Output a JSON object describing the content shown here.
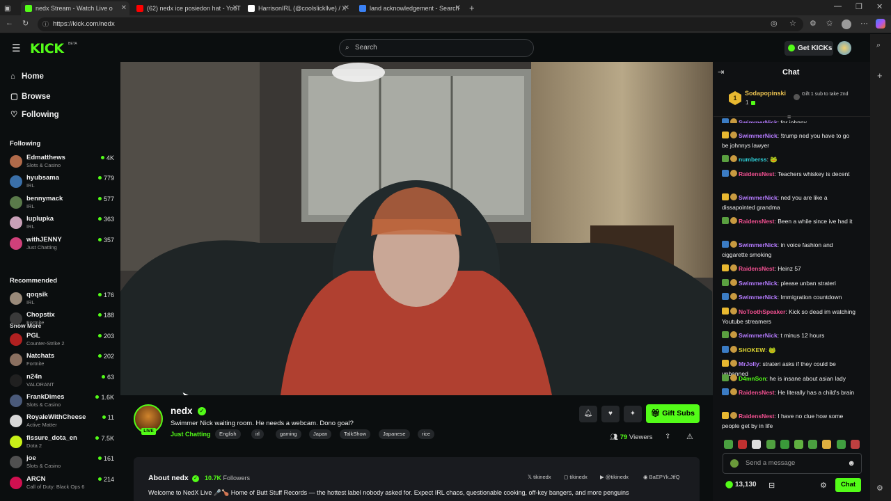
{
  "browser": {
    "tabs": [
      {
        "title": "nedx Stream - Watch Live o",
        "active": true,
        "icon_color": "#53fc18"
      },
      {
        "title": "(62) nedx ice posiedon hat - YouT",
        "active": false,
        "icon_color": "#ff0000"
      },
      {
        "title": "HarrisonIRL (@coolslickllve) / X",
        "active": false,
        "icon_color": "#ffffff"
      },
      {
        "title": "land acknowledgement - Search",
        "active": false,
        "icon_color": "#3b82f6"
      }
    ],
    "url": "https://kick.com/nedx"
  },
  "topbar": {
    "logo": "KICK",
    "logo_beta": "BETA",
    "search_placeholder": "Search",
    "get_kicks": "Get KICKs"
  },
  "sidebar": {
    "nav": [
      {
        "label": "Home",
        "icon": "home-icon"
      },
      {
        "label": "Browse",
        "icon": "browse-icon"
      },
      {
        "label": "Following",
        "icon": "heart-icon"
      }
    ],
    "following_title": "Following",
    "following": [
      {
        "name": "Edmatthews",
        "category": "Slots & Casino",
        "viewers": "4K",
        "color": "#b06a4a"
      },
      {
        "name": "hyubsama",
        "category": "IRL",
        "viewers": "779",
        "color": "#3a6fa8"
      },
      {
        "name": "bennymack",
        "category": "IRL",
        "viewers": "577",
        "color": "#5a7a4a"
      },
      {
        "name": "luplupka",
        "category": "IRL",
        "viewers": "363",
        "color": "#c9a0b8"
      },
      {
        "name": "withJENNY",
        "category": "Just Chatting",
        "viewers": "357",
        "color": "#d0407a"
      }
    ],
    "show_more": "Show More",
    "recommended_title": "Recommended",
    "recommended": [
      {
        "name": "qoqsik",
        "category": "IRL",
        "viewers": "176",
        "color": "#9a8a7a"
      },
      {
        "name": "Chopstix",
        "category": "Fortnite",
        "viewers": "188",
        "color": "#3a3a3a"
      },
      {
        "name": "PGL",
        "category": "Counter-Strike 2",
        "viewers": "203",
        "color": "#b02020"
      },
      {
        "name": "Natchats",
        "category": "Fortnite",
        "viewers": "202",
        "color": "#8a7060"
      },
      {
        "name": "n24n",
        "category": "VALORANT",
        "viewers": "63",
        "color": "#202020"
      },
      {
        "name": "FrankDimes",
        "category": "Slots & Casino",
        "viewers": "1.6K",
        "color": "#4a5a7a"
      },
      {
        "name": "RoyaleWithCheese",
        "category": "Active Matter",
        "viewers": "11",
        "color": "#d8d8d8"
      },
      {
        "name": "fissure_dota_en",
        "category": "Dota 2",
        "viewers": "7.5K",
        "color": "#c8f018"
      },
      {
        "name": "joe",
        "category": "Slots & Casino",
        "viewers": "161",
        "color": "#505050"
      },
      {
        "name": "ARCN",
        "category": "Call of Duty: Black Ops 6",
        "viewers": "214",
        "color": "#d01050"
      }
    ]
  },
  "stream": {
    "streamer": "nedx",
    "live_badge": "LIVE",
    "title": "Swimmer Nick waiting room. He needs a webcam. Dono goal?",
    "category": "Just Chatting",
    "tags": [
      "English",
      "irl",
      "gaming",
      "Japan",
      "TalkShow",
      "Japanese",
      "rice"
    ],
    "gift_subs": "Gift Subs",
    "viewers_count": "79",
    "viewers_label": "Viewers"
  },
  "about": {
    "title": "About nedx",
    "followers_count": "10.7K",
    "followers_label": "Followers",
    "socials": [
      "tikinedx",
      "tikinedx",
      "@tikinedx",
      "BaEPYk.JtfQ"
    ],
    "description": "Welcome to NedX Live 🎤🍗 Home of Butt Stuff Records — the hottest label nobody asked for. Expect IRL chaos, questionable cooking, off-key bangers, and more penguins"
  },
  "chat": {
    "title": "Chat",
    "pinned_user": "Sodapopinski",
    "pinned_rank": "1",
    "pinned_count": "1",
    "pinned_note": "Gift 1 sub to take 2nd",
    "messages": [
      {
        "user": "SwimmerNick",
        "color": "#b57bff",
        "text": "for johnny"
      },
      {
        "user": "SwimmerNick",
        "color": "#b57bff",
        "text": "!trump ned you have to go be johnnys lawyer"
      },
      {
        "user": "numberss",
        "color": "#2fd0d8",
        "text": "🐸"
      },
      {
        "user": "RaidensNest",
        "color": "#f05090",
        "text": "Teachers whiskey is decent"
      },
      {
        "user": "SwimmerNick",
        "color": "#b57bff",
        "text": "ned you are like a dissapointed grandma"
      },
      {
        "user": "RaidensNest",
        "color": "#f05090",
        "text": "Been a while since ive had it"
      },
      {
        "user": "SwimmerNick",
        "color": "#b57bff",
        "text": "in voice fashion and ciggarette smoking"
      },
      {
        "user": "RaidensNest",
        "color": "#f05090",
        "text": "Heinz 57"
      },
      {
        "user": "SwimmerNick",
        "color": "#b57bff",
        "text": "please unban strateri"
      },
      {
        "user": "SwimmerNick",
        "color": "#b57bff",
        "text": "Immigration countdown"
      },
      {
        "user": "NoToothSpeaker",
        "color": "#f05090",
        "text": "Kick so dead im watching Youtube streamers"
      },
      {
        "user": "SwimmerNick",
        "color": "#b57bff",
        "text": "t minus 12 hours"
      },
      {
        "user": "SHOKEW",
        "color": "#d8d030",
        "text": "🐸"
      },
      {
        "user": "MrJolly",
        "color": "#b57bff",
        "text": "strateri asks if they could be unbanned"
      },
      {
        "user": "D4mnSon",
        "color": "#53fc18",
        "text": "he is insane about asian lady"
      },
      {
        "user": "RaidensNest",
        "color": "#f05090",
        "text": "He literally has a child's brain"
      },
      {
        "user": "RaidensNest",
        "color": "#f05090",
        "text": "I have no clue how some people get by in life"
      }
    ],
    "input_placeholder": "Send a message",
    "points": "13,130",
    "send_label": "Chat"
  },
  "colors": {
    "accent": "#53fc18",
    "background": "#0b0e0f",
    "panel": "#191b1f"
  }
}
